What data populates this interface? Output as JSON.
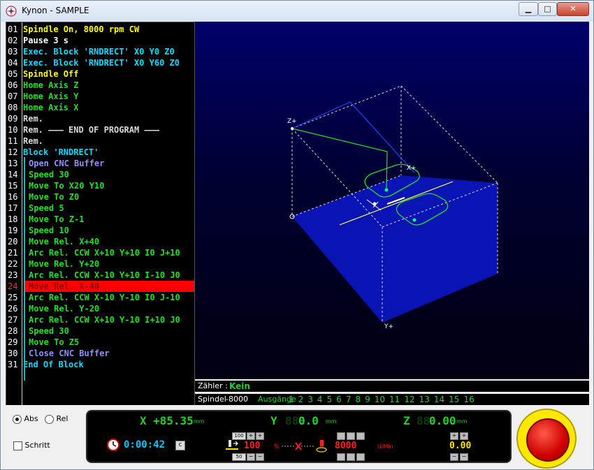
{
  "window": {
    "title": "Kynon  -  SAMPLE",
    "controls": {
      "minimize": "▁",
      "maximize": "□",
      "close": "✕"
    }
  },
  "program": {
    "lines": [
      {
        "n": "01",
        "text": "Spindle On, 8000 rpm CW",
        "color": "#ffff00",
        "indent": false
      },
      {
        "n": "02",
        "text": "Pause 3 s",
        "color": "#ffffff",
        "indent": false
      },
      {
        "n": "03",
        "text": "Exec. Block 'RNDRECT' X0 Y0 Z0",
        "color": "#00e0ff",
        "indent": false
      },
      {
        "n": "04",
        "text": "Exec. Block 'RNDRECT' X0 Y60 Z0",
        "color": "#00e0ff",
        "indent": false
      },
      {
        "n": "05",
        "text": "Spindle Off",
        "color": "#ffff00",
        "indent": false
      },
      {
        "n": "06",
        "text": "Home Axis Z",
        "color": "#22e022",
        "indent": false
      },
      {
        "n": "07",
        "text": "Home Axis Y",
        "color": "#22e022",
        "indent": false
      },
      {
        "n": "08",
        "text": "Home Axis X",
        "color": "#22e022",
        "indent": false
      },
      {
        "n": "09",
        "text": "Rem.",
        "color": "#d8d8d8",
        "indent": false
      },
      {
        "n": "10",
        "text": "Rem. ——— END OF PROGRAM ———",
        "color": "#d8d8d8",
        "indent": false
      },
      {
        "n": "11",
        "text": "Rem.",
        "color": "#d8d8d8",
        "indent": false
      },
      {
        "n": "12",
        "text": "Block 'RNDRECT'",
        "color": "#00e0ff",
        "indent": false
      },
      {
        "n": "13",
        "text": "Open CNC Buffer",
        "color": "#9090ff",
        "indent": true
      },
      {
        "n": "14",
        "text": "Speed 30",
        "color": "#22e022",
        "indent": true
      },
      {
        "n": "15",
        "text": "Move To X20 Y10",
        "color": "#22e022",
        "indent": true
      },
      {
        "n": "16",
        "text": "Move To Z0",
        "color": "#22e022",
        "indent": true
      },
      {
        "n": "17",
        "text": "Speed 5",
        "color": "#22e022",
        "indent": true
      },
      {
        "n": "18",
        "text": "Move To Z-1",
        "color": "#22e022",
        "indent": true
      },
      {
        "n": "19",
        "text": "Speed 10",
        "color": "#22e022",
        "indent": true
      },
      {
        "n": "20",
        "text": "Move Rel. X+40",
        "color": "#22e022",
        "indent": true
      },
      {
        "n": "21",
        "text": "Arc Rel. CCW X+10 Y+10 I0 J+10",
        "color": "#22e022",
        "indent": true
      },
      {
        "n": "22",
        "text": "Move Rel. Y+20",
        "color": "#22e022",
        "indent": true
      },
      {
        "n": "23",
        "text": "Arc Rel. CCW X-10 Y+10 I-10 J0",
        "color": "#22e022",
        "indent": true
      },
      {
        "n": "24",
        "text": "Move Rel. X-40",
        "color": "#ff3030",
        "indent": true,
        "selected": true
      },
      {
        "n": "25",
        "text": "Arc Rel. CCW X-10 Y-10 I0 J-10",
        "color": "#22e022",
        "indent": true
      },
      {
        "n": "26",
        "text": "Move Rel. Y-20",
        "color": "#22e022",
        "indent": true
      },
      {
        "n": "27",
        "text": "Arc Rel. CCW X+10 Y-10 I+10 J0",
        "color": "#22e022",
        "indent": true
      },
      {
        "n": "28",
        "text": "Speed 30",
        "color": "#22e022",
        "indent": true
      },
      {
        "n": "29",
        "text": "Move To Z5",
        "color": "#22e022",
        "indent": true
      },
      {
        "n": "30",
        "text": "Close CNC Buffer",
        "color": "#9090ff",
        "indent": true
      },
      {
        "n": "31",
        "text": "End Of Block",
        "color": "#00e0ff",
        "indent": false
      }
    ],
    "selected_index": 23,
    "selected_bg": "#ff0000"
  },
  "viewport": {
    "axis_labels": {
      "z": "Z+",
      "x": "X+",
      "y": "Y+"
    }
  },
  "status": {
    "counter_label": "Zähler :",
    "counter_value": "Kein",
    "spindle_label": "Spindel",
    "spindle_value": "-8000",
    "outputs_label": "Ausgänge",
    "outputs": [
      "1",
      "2",
      "3",
      "4",
      "5",
      "6",
      "7",
      "8",
      "9",
      "10",
      "11",
      "12",
      "13",
      "14",
      "15",
      "16"
    ]
  },
  "controls": {
    "mode_abs": "Abs",
    "mode_rel": "Rel",
    "mode_selected": "Abs",
    "step_label": "Schritt",
    "step_checked": false
  },
  "dro": {
    "x_label": "X",
    "x_value": "+85.35",
    "y_label": "Y",
    "y_value": "0.0",
    "z_label": "Z",
    "z_value": "0.00",
    "unit": "mm",
    "time": "0:00:42",
    "time_btn": "c",
    "feed_override": "100",
    "feed_top": "100",
    "feed_bottom": "50",
    "percent": "%",
    "spindle_value": "8000",
    "spindle_unit": "U/Min",
    "z_extra": "0.00"
  },
  "colors": {
    "dro_green": "#22d22a",
    "dro_cyan": "#00c8ff",
    "dro_red": "#ff2020",
    "dro_yellow": "#ffe000"
  }
}
